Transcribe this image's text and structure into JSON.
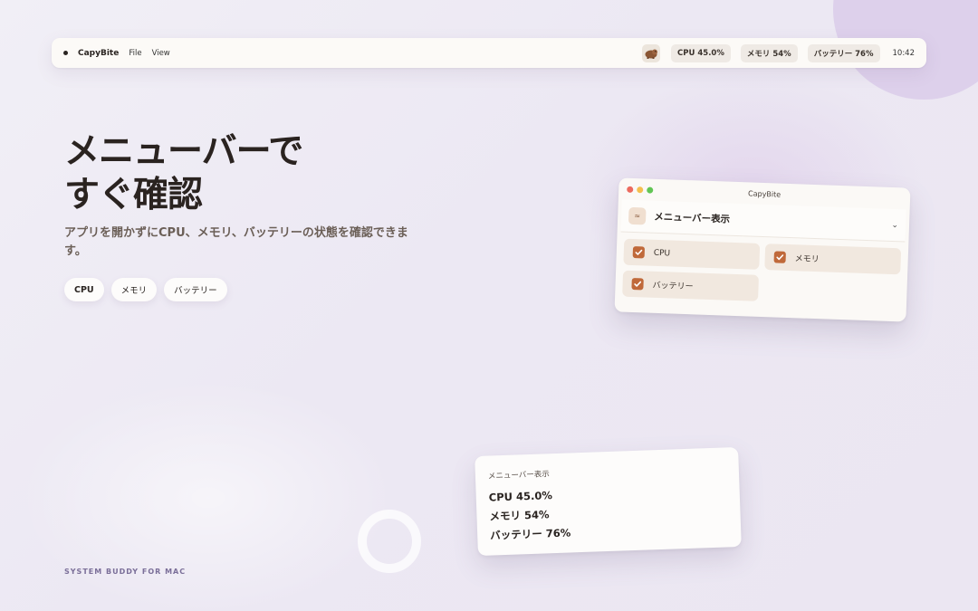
{
  "menubar": {
    "app_name": "CapyBite",
    "menu_items": [
      "File",
      "View"
    ],
    "stats": {
      "cpu": "CPU 45.0%",
      "memory": "メモリ 54%",
      "battery": "バッテリー 76%"
    },
    "clock": "10:42"
  },
  "hero": {
    "title_line1": "メニューバーで",
    "title_line2": "すぐ確認",
    "subtitle": "アプリを開かずにCPU、メモリ、バッテリーの状態を確認できます。",
    "chips": [
      "CPU",
      "メモリ",
      "バッテリー"
    ]
  },
  "tagline": "SYSTEM BUDDY FOR MAC",
  "window": {
    "title": "CapyBite",
    "section_title": "メニューバー表示",
    "section_icon": "≈",
    "options": [
      {
        "label": "CPU",
        "checked": true
      },
      {
        "label": "メモリ",
        "checked": true
      },
      {
        "label": "バッテリー",
        "checked": true
      }
    ]
  },
  "preview": {
    "label": "メニューバー表示",
    "lines": [
      "CPU 45.0%",
      "メモリ 54%",
      "バッテリー 76%"
    ]
  },
  "colors": {
    "accent": "#c0693a",
    "option_bg": "#f1e8df",
    "tagline": "#7b6f99"
  }
}
